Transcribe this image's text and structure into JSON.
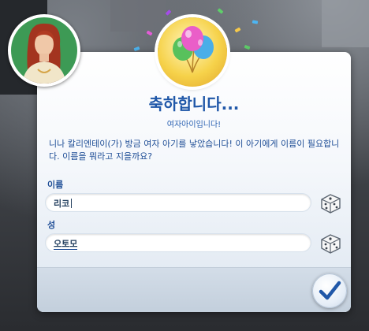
{
  "dialog": {
    "title": "축하합니다...",
    "subtitle": "여자아이입니다!",
    "message": "니나 칼리엔테이(가) 방금 여자 아기를 낳았습니다! 이 아기에게 이름이 필요합니다. 이름을 뭐라고 지을까요?",
    "first_name_label": "이름",
    "first_name_value": "리코",
    "last_name_label": "성",
    "last_name_value": "오토모",
    "randomize_icon": "dice-icon",
    "confirm_icon": "checkmark-icon"
  },
  "colors": {
    "title": "#1f57a8",
    "text": "#1e4d96",
    "badge": "#f6d24a",
    "confirm_check": "#1f57a8"
  }
}
